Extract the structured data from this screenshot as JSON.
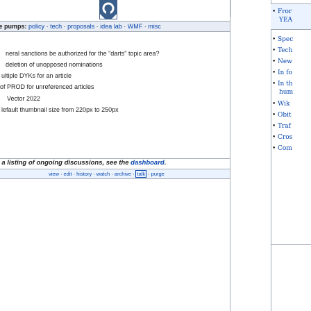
{
  "pumps_bar": {
    "label": "ge pumps:",
    "links": [
      "policy",
      "tech",
      "proposals",
      "idea lab",
      "WMF",
      "misc"
    ],
    "separator": "·"
  },
  "items": [
    "neral sanctions be authorized for the \"darts\" topic area?",
    "deletion of unopposed nominations",
    "ultiple DYKs for an article",
    "of PROD for unreferenced articles",
    "Vector 2022",
    "lefault thumbnail size from 220px to 250px"
  ],
  "listing": {
    "prefix": "r a listing of ongoing discussions, see the ",
    "link": "dashboard",
    "suffix": "."
  },
  "actions": {
    "links": [
      "view",
      "edit",
      "history",
      "watch",
      "archive"
    ],
    "boxed": "talk",
    "last": "purge",
    "separator": "·"
  },
  "right_panel": {
    "items": [
      {
        "text": "Fror",
        "sub": "YEA"
      },
      {
        "text": "Spec"
      },
      {
        "text": "Tech"
      },
      {
        "text": "New"
      },
      {
        "text": "In fo"
      },
      {
        "text": "In th",
        "sub": "hum"
      },
      {
        "text": "Wik"
      },
      {
        "text": "Obit"
      },
      {
        "text": "Traf"
      },
      {
        "text": "Cros"
      },
      {
        "text": "Com"
      }
    ]
  },
  "colors": {
    "link": "#0645ad",
    "text": "#202122",
    "header_bg": "#e8ecf4",
    "action_bg": "#eaf3ff",
    "border": "#a2a9b1"
  }
}
